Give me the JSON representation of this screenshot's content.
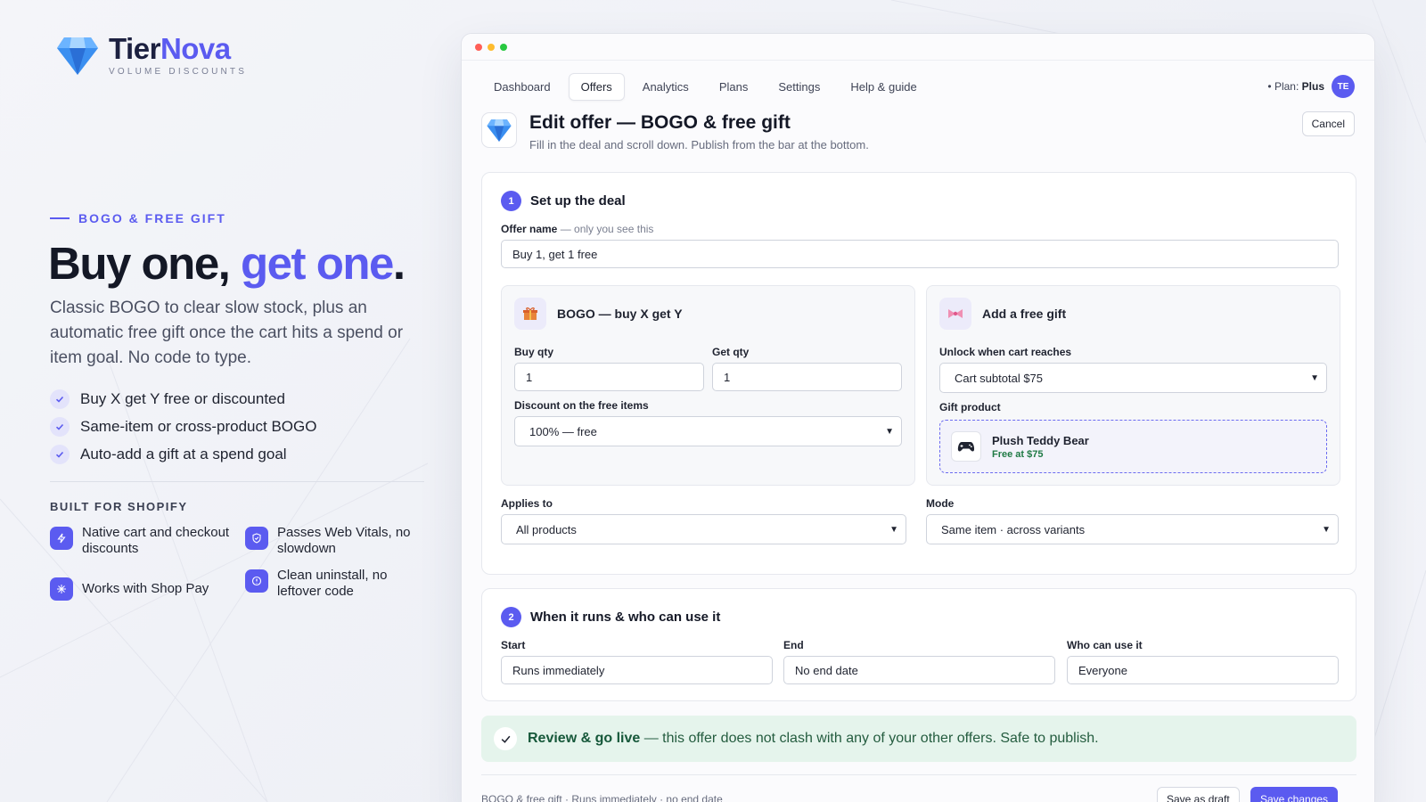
{
  "brand": {
    "name_a": "Tier",
    "name_b": "Nova",
    "tagline": "VOLUME DISCOUNTS"
  },
  "hero": {
    "eyebrow": "BOGO & FREE GIFT",
    "title_a": "Buy one, ",
    "title_b": "get one",
    "title_c": ".",
    "lede": "Classic BOGO to clear slow stock, plus an automatic free gift once the cart hits a spend or item goal. No code to type.",
    "bullets": [
      "Buy X get Y free or discounted",
      "Same-item or cross-product BOGO",
      "Auto-add a gift at a spend goal"
    ]
  },
  "built": {
    "title": "BUILT FOR SHOPIFY",
    "features": [
      {
        "label": "Native cart and checkout discounts",
        "icon": "bolt-icon"
      },
      {
        "label": "Passes Web Vitals, no slowdown",
        "icon": "shield-icon"
      },
      {
        "label": "Works with Shop Pay",
        "icon": "sparkle-icon"
      },
      {
        "label": "Clean uninstall, no leftover code",
        "icon": "info-icon"
      }
    ]
  },
  "nav": {
    "tabs": [
      "Dashboard",
      "Offers",
      "Analytics",
      "Plans",
      "Settings",
      "Help & guide"
    ],
    "active": "Offers",
    "plan_prefix": "• Plan:",
    "plan_name": "Plus",
    "avatar": "TE"
  },
  "header": {
    "title": "Edit offer — BOGO & free gift",
    "subtitle": "Fill in the deal and scroll down. Publish from the bar at the bottom.",
    "cancel": "Cancel"
  },
  "section1": {
    "number": "1",
    "title": "Set up the deal",
    "offer_name_label": "Offer name",
    "offer_name_hint": " — only you see this",
    "offer_name_value": "Buy 1, get 1 free",
    "bogo": {
      "title": "BOGO — buy X get Y",
      "buy_label": "Buy qty",
      "buy_value": "1",
      "get_label": "Get qty",
      "get_value": "1",
      "discount_label": "Discount on the free items",
      "discount_value": "100% — free"
    },
    "gift": {
      "title": "Add a free gift",
      "unlock_label": "Unlock when cart reaches",
      "unlock_value": "Cart subtotal $75",
      "product_label": "Gift product",
      "product_name": "Plush Teddy Bear",
      "product_note": "Free at $75"
    },
    "applies_label": "Applies to",
    "applies_value": "All products",
    "mode_label": "Mode",
    "mode_value": "Same item · across variants"
  },
  "section2": {
    "number": "2",
    "title": "When it runs & who can use it",
    "start_label": "Start",
    "start_value": "Runs immediately",
    "end_label": "End",
    "end_value": "No end date",
    "who_label": "Who can use it",
    "who_value": "Everyone"
  },
  "review": {
    "strong": "Review & go live",
    "text": " — this offer does not clash with any of your other offers. Safe to publish."
  },
  "footer": {
    "summary": "BOGO & free gift · Runs immediately · no end date",
    "draft": "Save as draft",
    "save": "Save changes"
  },
  "colors": {
    "accent": "#5b5bf0",
    "success_bg": "#e5f4ec",
    "success_text": "#16583a"
  }
}
